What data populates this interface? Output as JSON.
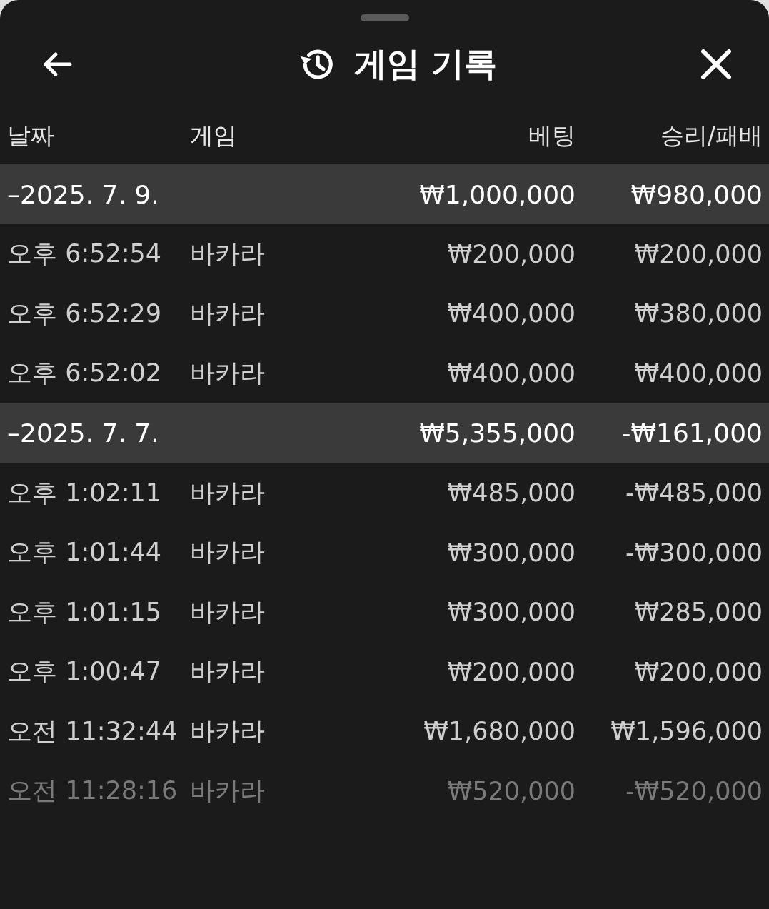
{
  "header": {
    "title": "게임 기록"
  },
  "columns": [
    "날짜",
    "게임",
    "베팅",
    "승리/패배"
  ],
  "groups": [
    {
      "date": "–2025. 7. 9.",
      "bet": "₩1,000,000",
      "result": "₩980,000",
      "rows": [
        {
          "time": "오후 6:52:54",
          "game": "바카라",
          "bet": "₩200,000",
          "result": "₩200,000"
        },
        {
          "time": "오후 6:52:29",
          "game": "바카라",
          "bet": "₩400,000",
          "result": "₩380,000"
        },
        {
          "time": "오후 6:52:02",
          "game": "바카라",
          "bet": "₩400,000",
          "result": "₩400,000"
        }
      ]
    },
    {
      "date": "–2025. 7. 7.",
      "bet": "₩5,355,000",
      "result": "-₩161,000",
      "rows": [
        {
          "time": "오후 1:02:11",
          "game": "바카라",
          "bet": "₩485,000",
          "result": "-₩485,000"
        },
        {
          "time": "오후 1:01:44",
          "game": "바카라",
          "bet": "₩300,000",
          "result": "-₩300,000"
        },
        {
          "time": "오후 1:01:15",
          "game": "바카라",
          "bet": "₩300,000",
          "result": "₩285,000"
        },
        {
          "time": "오후 1:00:47",
          "game": "바카라",
          "bet": "₩200,000",
          "result": "₩200,000"
        },
        {
          "time": "오전 11:32:44",
          "game": "바카라",
          "bet": "₩1,680,000",
          "result": "₩1,596,000"
        },
        {
          "time": "오전 11:28:16",
          "game": "바카라",
          "bet": "₩520,000",
          "result": "-₩520,000"
        }
      ]
    }
  ]
}
